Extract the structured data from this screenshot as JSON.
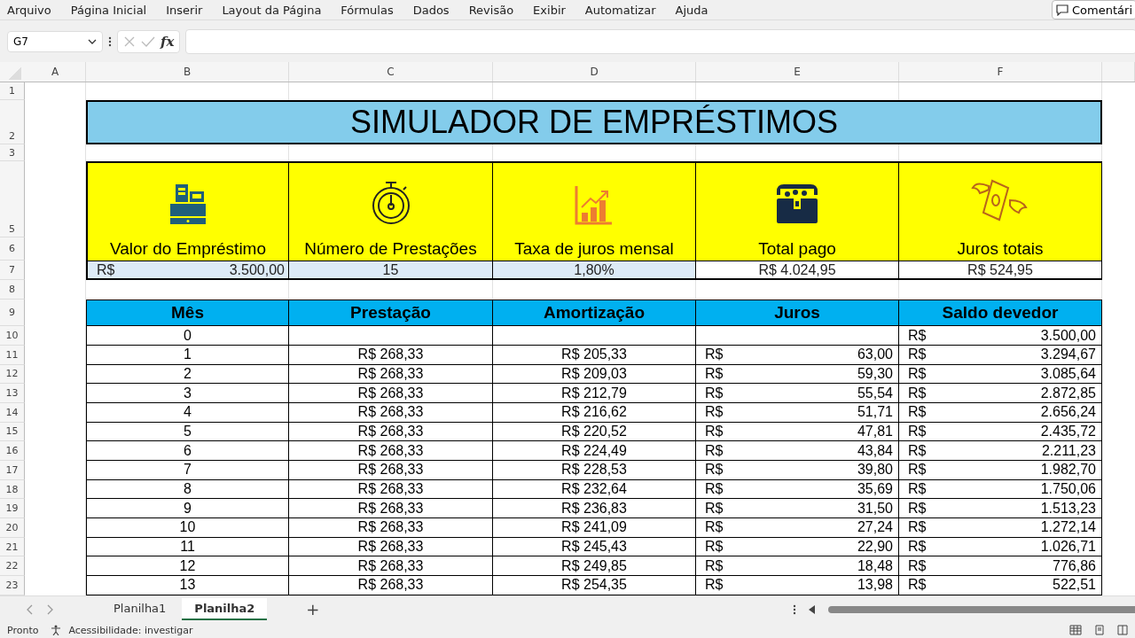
{
  "menu": [
    "Arquivo",
    "Página Inicial",
    "Inserir",
    "Layout da Página",
    "Fórmulas",
    "Dados",
    "Revisão",
    "Exibir",
    "Automatizar",
    "Ajuda"
  ],
  "comment_button": "Comentári",
  "name_box": "G7",
  "formula_icon": "fx",
  "columns": [
    "A",
    "B",
    "C",
    "D",
    "E",
    "F"
  ],
  "row_numbers": [
    "1",
    "2",
    "3",
    "5",
    "6",
    "7",
    "8",
    "9",
    "10",
    "11",
    "12",
    "13",
    "14",
    "15",
    "16",
    "17",
    "18",
    "19",
    "20",
    "21",
    "22",
    "23"
  ],
  "title": "SIMULADOR DE EMPRÉSTIMOS",
  "summary": [
    {
      "label": "Valor do Empréstimo",
      "currency": "R$",
      "value": "3.500,00",
      "kind": "input"
    },
    {
      "label": "Número de Prestações",
      "value": "15",
      "kind": "input"
    },
    {
      "label": "Taxa de juros mensal",
      "value": "1,80%",
      "kind": "input"
    },
    {
      "label": "Total pago",
      "value": "R$ 4.024,95",
      "kind": "output"
    },
    {
      "label": "Juros totais",
      "value": "R$ 524,95",
      "kind": "output"
    }
  ],
  "table": {
    "columns": [
      "Mês",
      "Prestação",
      "Amortização",
      "Juros",
      "Saldo devedor"
    ],
    "rows": [
      {
        "mes": "0",
        "saldo_currency": "R$",
        "saldo": "3.500,00"
      },
      {
        "mes": "1",
        "prestacao": "R$ 268,33",
        "amortizacao": "R$ 205,33",
        "juros_currency": "R$",
        "juros": "63,00",
        "saldo_currency": "R$",
        "saldo": "3.294,67"
      },
      {
        "mes": "2",
        "prestacao": "R$ 268,33",
        "amortizacao": "R$ 209,03",
        "juros_currency": "R$",
        "juros": "59,30",
        "saldo_currency": "R$",
        "saldo": "3.085,64"
      },
      {
        "mes": "3",
        "prestacao": "R$ 268,33",
        "amortizacao": "R$ 212,79",
        "juros_currency": "R$",
        "juros": "55,54",
        "saldo_currency": "R$",
        "saldo": "2.872,85"
      },
      {
        "mes": "4",
        "prestacao": "R$ 268,33",
        "amortizacao": "R$ 216,62",
        "juros_currency": "R$",
        "juros": "51,71",
        "saldo_currency": "R$",
        "saldo": "2.656,24"
      },
      {
        "mes": "5",
        "prestacao": "R$ 268,33",
        "amortizacao": "R$ 220,52",
        "juros_currency": "R$",
        "juros": "47,81",
        "saldo_currency": "R$",
        "saldo": "2.435,72"
      },
      {
        "mes": "6",
        "prestacao": "R$ 268,33",
        "amortizacao": "R$ 224,49",
        "juros_currency": "R$",
        "juros": "43,84",
        "saldo_currency": "R$",
        "saldo": "2.211,23"
      },
      {
        "mes": "7",
        "prestacao": "R$ 268,33",
        "amortizacao": "R$ 228,53",
        "juros_currency": "R$",
        "juros": "39,80",
        "saldo_currency": "R$",
        "saldo": "1.982,70"
      },
      {
        "mes": "8",
        "prestacao": "R$ 268,33",
        "amortizacao": "R$ 232,64",
        "juros_currency": "R$",
        "juros": "35,69",
        "saldo_currency": "R$",
        "saldo": "1.750,06"
      },
      {
        "mes": "9",
        "prestacao": "R$ 268,33",
        "amortizacao": "R$ 236,83",
        "juros_currency": "R$",
        "juros": "31,50",
        "saldo_currency": "R$",
        "saldo": "1.513,23"
      },
      {
        "mes": "10",
        "prestacao": "R$ 268,33",
        "amortizacao": "R$ 241,09",
        "juros_currency": "R$",
        "juros": "27,24",
        "saldo_currency": "R$",
        "saldo": "1.272,14"
      },
      {
        "mes": "11",
        "prestacao": "R$ 268,33",
        "amortizacao": "R$ 245,43",
        "juros_currency": "R$",
        "juros": "22,90",
        "saldo_currency": "R$",
        "saldo": "1.026,71"
      },
      {
        "mes": "12",
        "prestacao": "R$ 268,33",
        "amortizacao": "R$ 249,85",
        "juros_currency": "R$",
        "juros": "18,48",
        "saldo_currency": "R$",
        "saldo": "776,86"
      },
      {
        "mes": "13",
        "prestacao": "R$ 268,33",
        "amortizacao": "R$ 254,35",
        "juros_currency": "R$",
        "juros": "13,98",
        "saldo_currency": "R$",
        "saldo": "522,51"
      }
    ]
  },
  "sheets": [
    {
      "label": "Planilha1",
      "selected": false
    },
    {
      "label": "Planilha2",
      "selected": true
    }
  ],
  "add_sheet": "+",
  "status": [
    "Pronto",
    "Acessibilidade: investigar"
  ]
}
